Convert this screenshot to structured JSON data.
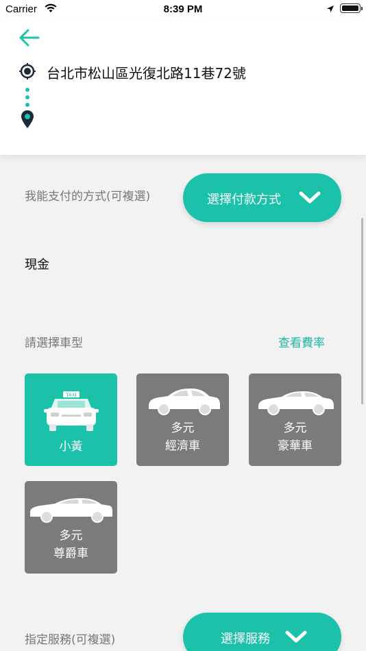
{
  "status_bar": {
    "carrier": "Carrier",
    "time": "8:39 PM",
    "icons": [
      "wifi-icon",
      "location-arrow-icon",
      "battery-icon"
    ]
  },
  "header": {
    "back_icon": "arrow-left-icon",
    "origin_address": "台北市松山區光復北路11巷72號",
    "origin_icon": "target-circle-icon",
    "destination_icon": "map-pin-icon",
    "destination_address": ""
  },
  "payment": {
    "label": "我能支付的方式(可複選)",
    "button_label": "選擇付款方式",
    "selected_method": "現金"
  },
  "car_type": {
    "label": "請選擇車型",
    "fare_link": "查看費率",
    "options": [
      {
        "name": "小黃",
        "selected": true,
        "icon": "taxi-icon"
      },
      {
        "line1": "多元",
        "line2": "經濟車",
        "selected": false,
        "icon": "sedan-icon"
      },
      {
        "line1": "多元",
        "line2": "豪華車",
        "selected": false,
        "icon": "luxury-sedan-icon"
      },
      {
        "line1": "多元",
        "line2": "尊爵車",
        "selected": false,
        "icon": "premium-sedan-icon"
      }
    ]
  },
  "service": {
    "label": "指定服務(可複選)",
    "button_label": "選擇服務"
  },
  "colors": {
    "accent": "#1cc1aa",
    "unselected_card": "#7b7b7b",
    "background": "#f2f2f2",
    "link": "#1cb7a3",
    "marker": "#1a2a3a"
  }
}
